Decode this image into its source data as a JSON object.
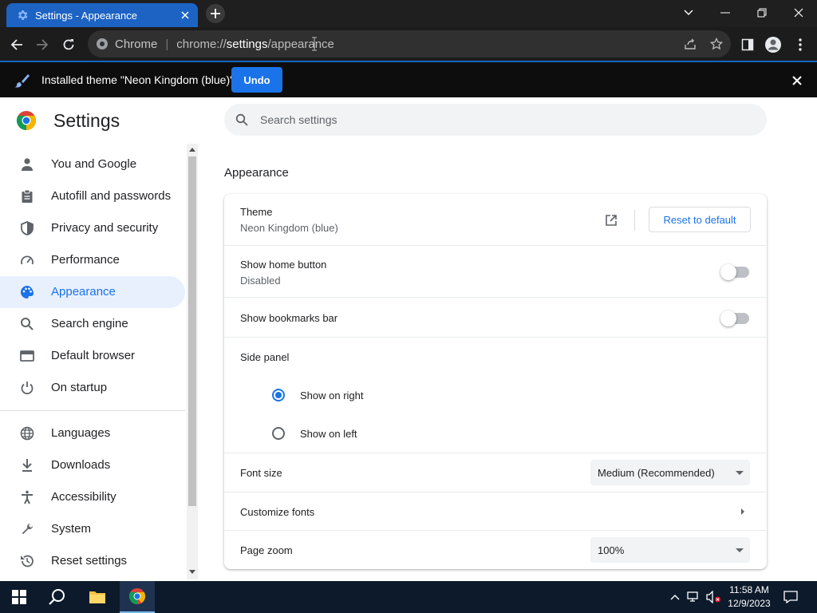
{
  "window": {
    "tab_title": "Settings - Appearance",
    "controls": [
      "chevron-down-icon",
      "minimize-icon",
      "restore-icon",
      "close-icon"
    ]
  },
  "toolbar": {
    "site_name": "Chrome",
    "url_host": "chrome://",
    "url_path_strong": "settings",
    "url_path_rest": "/appearance"
  },
  "infobar": {
    "message": "Installed theme \"Neon Kingdom (blue)\"",
    "undo_label": "Undo"
  },
  "settings": {
    "title": "Settings",
    "search_placeholder": "Search settings"
  },
  "sidebar": {
    "items": [
      {
        "label": "You and Google",
        "icon": "person-icon"
      },
      {
        "label": "Autofill and passwords",
        "icon": "clipboard-icon"
      },
      {
        "label": "Privacy and security",
        "icon": "shield-icon"
      },
      {
        "label": "Performance",
        "icon": "speedometer-icon"
      },
      {
        "label": "Appearance",
        "icon": "palette-icon",
        "active": true
      },
      {
        "label": "Search engine",
        "icon": "search-icon"
      },
      {
        "label": "Default browser",
        "icon": "browser-icon"
      },
      {
        "label": "On startup",
        "icon": "power-icon"
      },
      {
        "label": "Languages",
        "icon": "globe-icon"
      },
      {
        "label": "Downloads",
        "icon": "download-icon"
      },
      {
        "label": "Accessibility",
        "icon": "accessibility-icon"
      },
      {
        "label": "System",
        "icon": "wrench-icon"
      },
      {
        "label": "Reset settings",
        "icon": "history-icon"
      }
    ]
  },
  "appearance": {
    "section_title": "Appearance",
    "theme_label": "Theme",
    "theme_value": "Neon Kingdom (blue)",
    "reset_label": "Reset to default",
    "home_button_label": "Show home button",
    "home_button_value": "Disabled",
    "bookmarks_bar_label": "Show bookmarks bar",
    "side_panel_label": "Side panel",
    "side_panel_right": "Show on right",
    "side_panel_left": "Show on left",
    "font_size_label": "Font size",
    "font_size_value": "Medium (Recommended)",
    "customize_fonts_label": "Customize fonts",
    "page_zoom_label": "Page zoom",
    "page_zoom_value": "100%"
  },
  "taskbar": {
    "time": "11:58 AM",
    "date": "12/9/2023"
  },
  "colors": {
    "accent": "#1a73e8",
    "tab": "#1c63c4",
    "titlebar": "#1f1f1f",
    "taskbar": "#0c1a2b"
  }
}
